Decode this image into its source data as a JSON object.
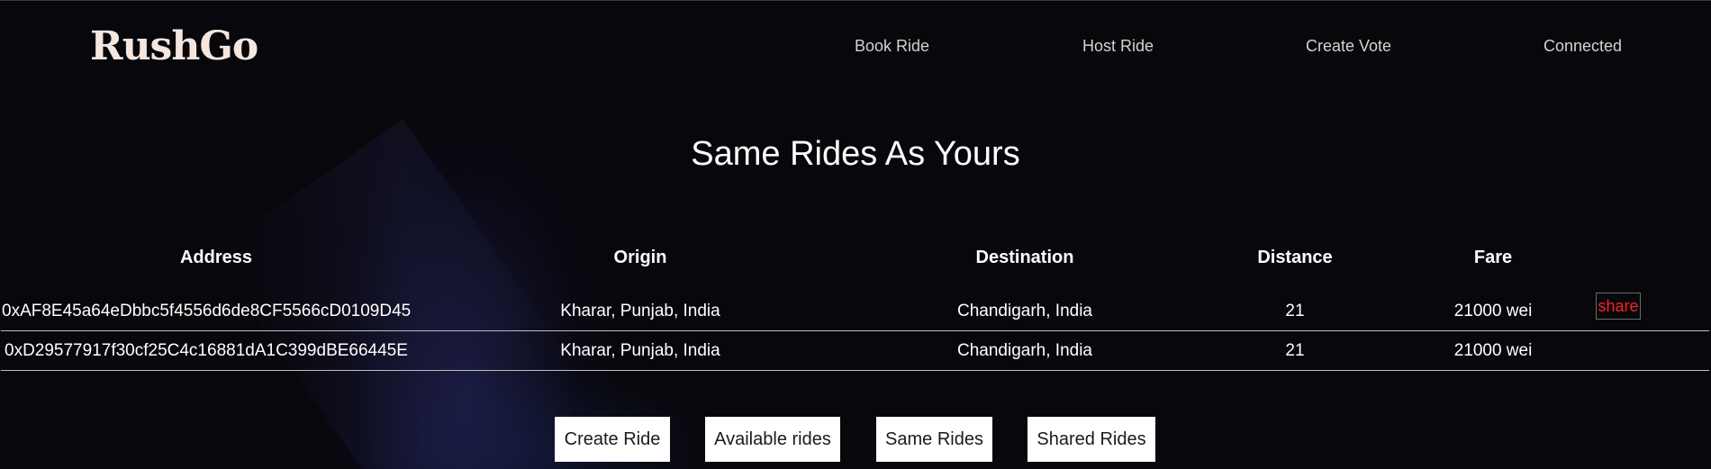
{
  "brand": {
    "name": "RushGo"
  },
  "nav": {
    "book_ride": "Book Ride",
    "host_ride": "Host Ride",
    "create_vote": "Create Vote",
    "connected": "Connected"
  },
  "page_title": "Same Rides As Yours",
  "table": {
    "columns": [
      "Address",
      "Origin",
      "Destination",
      "Distance",
      "Fare"
    ],
    "rows": [
      {
        "address": "0xAF8E45a64eDbbc5f4556d6de8CF5566cD0109D45",
        "origin": "Kharar, Punjab, India",
        "destination": "Chandigarh, India",
        "distance": "21",
        "fare": "21000 wei",
        "action": "share"
      },
      {
        "address": "0xD29577917f30cf25C4c16881dA1C399dBE66445E",
        "origin": "Kharar, Punjab, India",
        "destination": "Chandigarh, India",
        "distance": "21",
        "fare": "21000 wei"
      }
    ]
  },
  "actions": {
    "create_ride": "Create Ride",
    "available_rides": "Available rides",
    "same_rides": "Same Rides",
    "shared_rides": "Shared Rides"
  },
  "colors": {
    "background": "#08070b",
    "logo": "#f5e6e0",
    "share_text": "#ff2020"
  }
}
